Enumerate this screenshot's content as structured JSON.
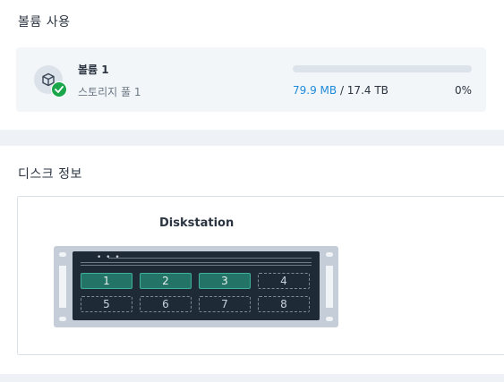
{
  "volume_section": {
    "title": "볼륨 사용",
    "volume": {
      "name": "볼륨 1",
      "pool": "스토리지 풀 1",
      "used": "79.9 MB",
      "separator": " / ",
      "total": "17.4 TB",
      "percent": "0%",
      "usage_fraction": 0.0,
      "status": "healthy",
      "icon": "volume-cube-icon"
    }
  },
  "disk_section": {
    "title": "디스크 정보",
    "device_name": "Diskstation",
    "indicator": "• • •",
    "bays": [
      {
        "label": "1",
        "installed": true
      },
      {
        "label": "2",
        "installed": true
      },
      {
        "label": "3",
        "installed": true
      },
      {
        "label": "4",
        "installed": false
      },
      {
        "label": "5",
        "installed": false
      },
      {
        "label": "6",
        "installed": false
      },
      {
        "label": "7",
        "installed": false
      },
      {
        "label": "8",
        "installed": false
      }
    ]
  },
  "colors": {
    "accent": "#1f8ad8",
    "healthy": "#1ba64b",
    "drive_installed": "#237466",
    "background": "#eef2f6"
  }
}
